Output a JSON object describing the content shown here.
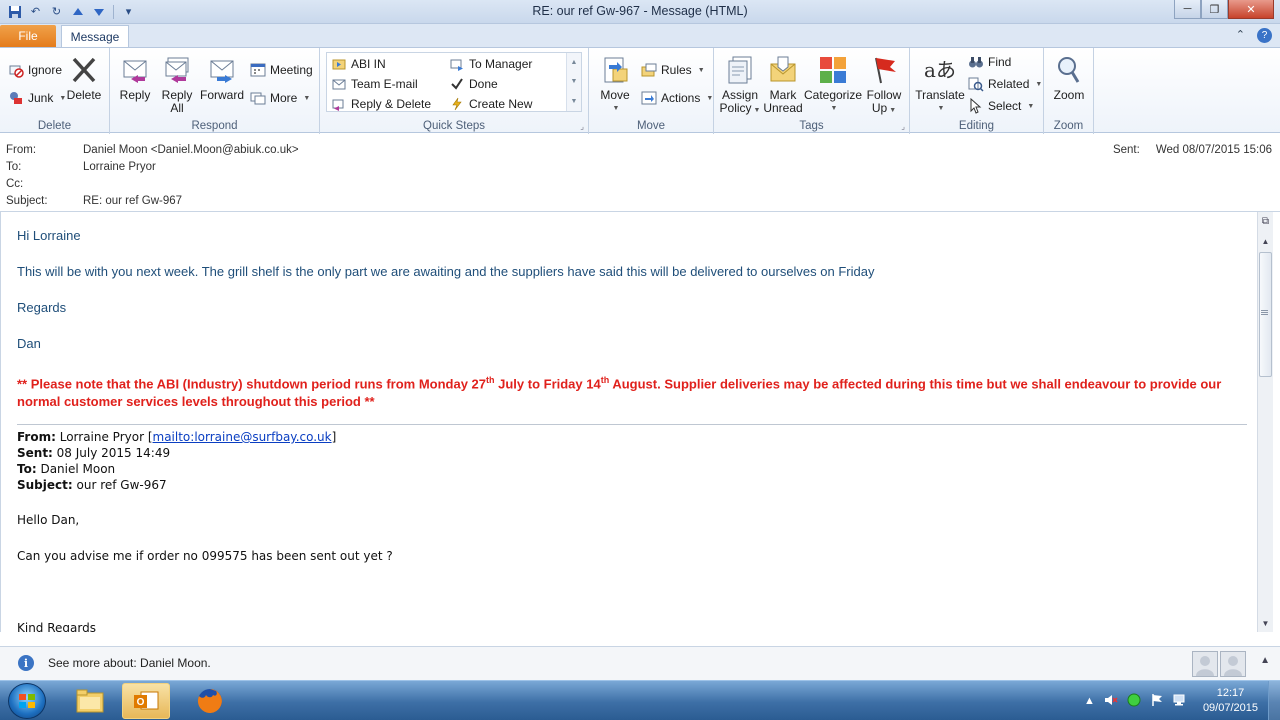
{
  "window": {
    "title": "RE: our ref Gw-967  -  Message (HTML)",
    "minimize": "─",
    "maximize": "❐",
    "close": "✕"
  },
  "tabs": {
    "file": "File",
    "message": "Message"
  },
  "ribbon": {
    "delete_group": {
      "label": "Delete",
      "ignore": "Ignore",
      "junk": "Junk",
      "delete": "Delete"
    },
    "respond_group": {
      "label": "Respond",
      "reply": "Reply",
      "reply_all_1": "Reply",
      "reply_all_2": "All",
      "forward": "Forward",
      "meeting": "Meeting",
      "more": "More"
    },
    "quick_steps": {
      "label": "Quick Steps",
      "items": [
        "ABI IN",
        "To Manager",
        "Team E-mail",
        "Done",
        "Reply & Delete",
        "Create New"
      ]
    },
    "move_group": {
      "label": "Move",
      "move": "Move",
      "rules": "Rules",
      "actions": "Actions"
    },
    "tags_group": {
      "label": "Tags",
      "assign_1": "Assign",
      "assign_2": "Policy",
      "mark_1": "Mark",
      "mark_2": "Unread",
      "categorize": "Categorize",
      "follow_1": "Follow",
      "follow_2": "Up"
    },
    "editing_group": {
      "label": "Editing",
      "translate": "Translate",
      "find": "Find",
      "related": "Related",
      "select": "Select"
    },
    "zoom_group": {
      "label": "Zoom",
      "zoom": "Zoom"
    }
  },
  "header": {
    "from_label": "From:",
    "from_value": "Daniel Moon <Daniel.Moon@abiuk.co.uk>",
    "to_label": "To:",
    "to_value": "Lorraine Pryor",
    "cc_label": "Cc:",
    "cc_value": "",
    "subject_label": "Subject:",
    "subject_value": "RE: our ref Gw-967",
    "sent_label": "Sent:",
    "sent_value": "Wed 08/07/2015 15:06"
  },
  "body": {
    "greeting": "Hi Lorraine",
    "line1": "This will be with you next week. The grill shelf is the only part we are awaiting and the suppliers have said this will be delivered to ourselves on Friday",
    "regards": "Regards",
    "signature": "Dan",
    "notice_a": "** Please note that the ABI (Industry) shutdown period runs from Monday 27",
    "notice_sup1": "th",
    "notice_b": " July to Friday 14",
    "notice_sup2": "th",
    "notice_c": " August.  Supplier deliveries may be affected during this time but we shall endeavour to provide our normal customer services levels throughout this period **",
    "quoted": {
      "from_label": "From:",
      "from_name": " Lorraine Pryor [",
      "from_link": "mailto:lorraine@surfbay.co.uk",
      "from_end": "]",
      "sent_label": "Sent:",
      "sent_value": " 08 July 2015 14:49",
      "to_label": "To:",
      "to_value": " Daniel Moon",
      "subject_label": "Subject:",
      "subject_value": " our ref Gw-967",
      "greeting": "Hello Dan,",
      "question": "Can you advise me if order no 099575 has been sent out yet ?",
      "closing": "Kind Regards"
    }
  },
  "people_pane": {
    "text": "See more about: Daniel Moon."
  },
  "taskbar": {
    "time": "12:17",
    "date": "09/07/2015"
  },
  "colors": {
    "body_text": "#1f4e79",
    "notice_red": "#e0211c",
    "file_tab": "#e47c1c",
    "link": "#0a3ec2"
  }
}
